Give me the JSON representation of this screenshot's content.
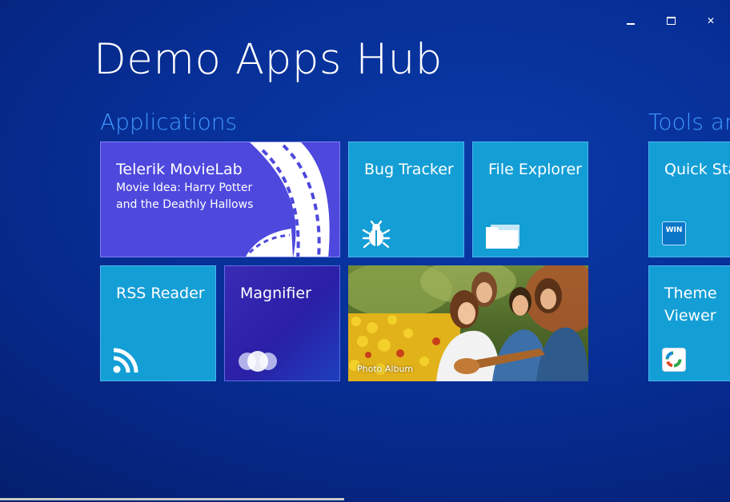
{
  "window": {
    "controls": [
      "minimize-icon",
      "maximize-icon",
      "close-icon"
    ],
    "close_glyph": "✕"
  },
  "hub": {
    "title": "Demo Apps Hub"
  },
  "groups": [
    {
      "title": "Applications"
    },
    {
      "title": "Tools an"
    }
  ],
  "tiles": {
    "movielab": {
      "label": "Telerik MovieLab",
      "subtitle": "Movie Idea: Harry Potter and the Deathly Hallows",
      "icon": "film-strip-icon"
    },
    "bug_tracker": {
      "label": "Bug Tracker",
      "icon": "bug-icon"
    },
    "file_explorer": {
      "label": "File Explorer",
      "icon": "folder-icon"
    },
    "rss_reader": {
      "label": "RSS Reader",
      "icon": "rss-icon"
    },
    "magnifier": {
      "label": "Magnifier",
      "icon": "magnifier-circles-icon"
    },
    "photo_album": {
      "label": "Photo Album"
    },
    "quick_start": {
      "label": "Quick Sta",
      "badge": "WIN",
      "icon": "win-badge-icon"
    },
    "theme_viewer": {
      "label": "Theme Viewer",
      "icon": "theme-palette-icon"
    }
  },
  "colors": {
    "background": "#072f97",
    "accent_text": "#3f99ff",
    "tile_cyan": "#149ed6",
    "tile_movielab": "#4e48dd",
    "tile_magnifier": "#2a1fa6"
  }
}
